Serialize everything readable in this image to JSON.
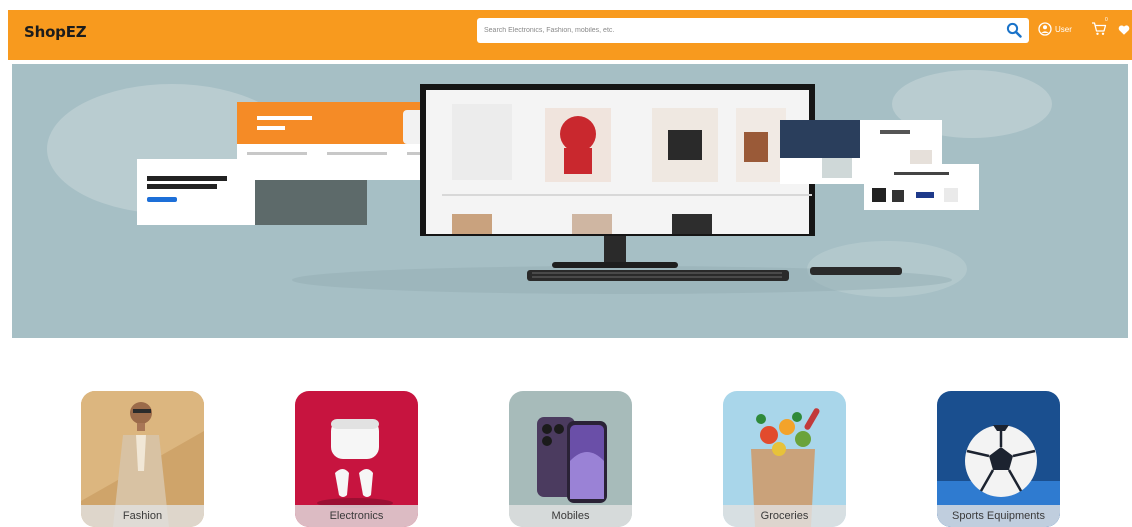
{
  "header": {
    "brand": "ShopEZ",
    "search": {
      "placeholder": "Search Electronics, Fashion, mobiles, etc.",
      "value": "",
      "icon": "search-icon"
    },
    "user_label": "User",
    "cart_count": "0",
    "icons": [
      "user-circle-icon",
      "cart-icon",
      "heart-icon"
    ],
    "colors": {
      "header_bg": "#f89a1e",
      "search_icon": "#1a73c9",
      "banner_bg": "#a6bfc5"
    }
  },
  "categories": [
    {
      "label": "Fashion"
    },
    {
      "label": "Electronics"
    },
    {
      "label": "Mobiles"
    },
    {
      "label": "Groceries"
    },
    {
      "label": "Sports Equipments"
    }
  ]
}
